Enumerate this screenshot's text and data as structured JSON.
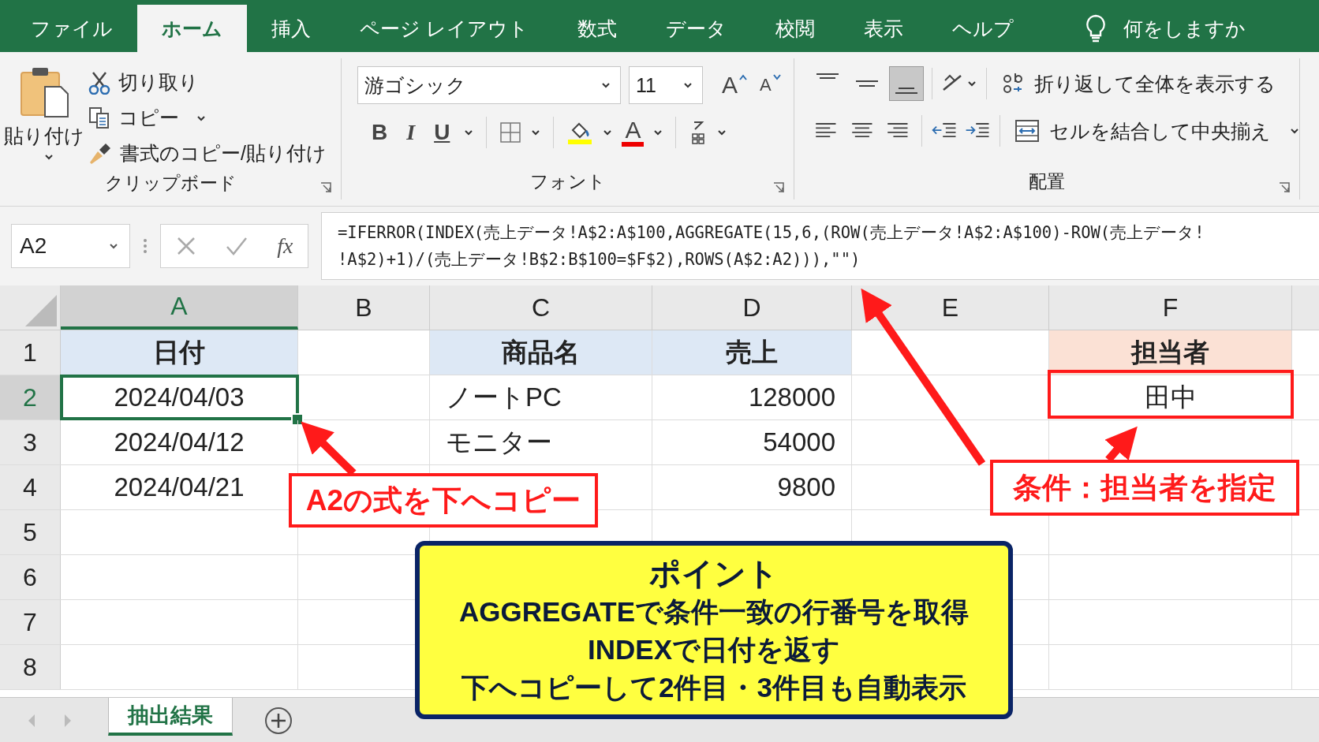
{
  "tabs": [
    {
      "label": "ファイル",
      "selected": false
    },
    {
      "label": "ホーム",
      "selected": true
    },
    {
      "label": "挿入",
      "selected": false
    },
    {
      "label": "ページ レイアウト",
      "selected": false
    },
    {
      "label": "数式",
      "selected": false
    },
    {
      "label": "データ",
      "selected": false
    },
    {
      "label": "校閲",
      "selected": false
    },
    {
      "label": "表示",
      "selected": false
    },
    {
      "label": "ヘルプ",
      "selected": false
    }
  ],
  "tell_me": "何をしますか",
  "clipboard": {
    "paste": "貼り付け",
    "cut": "切り取り",
    "copy": "コピー",
    "format_painter": "書式のコピー/貼り付け",
    "group_label": "クリップボード"
  },
  "font": {
    "name": "游ゴシック",
    "size": "11",
    "grow": "A",
    "shrink": "A",
    "bold": "B",
    "italic": "I",
    "underline": "U",
    "font_color": "A",
    "group_label": "フォント"
  },
  "alignment": {
    "wrap_text": "折り返して全体を表示する",
    "merge": "セルを結合して中央揃え",
    "group_label": "配置"
  },
  "formula_bar": {
    "name_box": "A2",
    "fx": "fx",
    "formula_lines": [
      "=IFERROR(INDEX(売上データ!A$2:A$100,AGGREGATE(15,6,(ROW(売上データ!A$2:A$100)-ROW(売上データ!",
      "!A$2)+1)/(売上データ!B$2:B$100=$F$2),ROWS(A$2:A2))),\"\")"
    ]
  },
  "columns": [
    {
      "label": "A",
      "selected": true
    },
    {
      "label": "B",
      "selected": false
    },
    {
      "label": "C",
      "selected": false
    },
    {
      "label": "D",
      "selected": false
    },
    {
      "label": "E",
      "selected": false
    },
    {
      "label": "F",
      "selected": false
    }
  ],
  "rows": [
    {
      "label": "1",
      "selected": false,
      "cells": [
        {
          "text": "日付",
          "kind": "header",
          "color": "#dde8f5"
        },
        null,
        {
          "text": "商品名",
          "kind": "header",
          "color": "#dde8f5"
        },
        {
          "text": "売上",
          "kind": "header",
          "color": "#dde8f5"
        },
        null,
        {
          "text": "担当者",
          "kind": "header",
          "color": "#fbe1d5"
        }
      ]
    },
    {
      "label": "2",
      "selected": true,
      "cells": [
        {
          "text": "2024/04/03",
          "kind": "date",
          "selected": true
        },
        null,
        {
          "text": "ノートPC",
          "kind": "text"
        },
        {
          "text": "128000",
          "kind": "number"
        },
        null,
        {
          "text": "田中",
          "kind": "date"
        }
      ]
    },
    {
      "label": "3",
      "selected": false,
      "cells": [
        {
          "text": "2024/04/12",
          "kind": "date"
        },
        null,
        {
          "text": "モニター",
          "kind": "text"
        },
        {
          "text": "54000",
          "kind": "number"
        },
        null,
        null
      ]
    },
    {
      "label": "4",
      "selected": false,
      "cells": [
        {
          "text": "2024/04/21",
          "kind": "date"
        },
        null,
        null,
        {
          "text": "9800",
          "kind": "number"
        },
        null,
        null
      ]
    },
    {
      "label": "5",
      "selected": false
    },
    {
      "label": "6",
      "selected": false
    },
    {
      "label": "7",
      "selected": false
    },
    {
      "label": "8",
      "selected": false
    }
  ],
  "sheet_tabs": [
    {
      "label": "抽出結果",
      "selected": true
    }
  ],
  "callouts": [
    {
      "text": "A2の式を下へコピー"
    },
    {
      "text": "条件：担当者を指定"
    }
  ],
  "point_box": {
    "title": "ポイント",
    "lines": [
      "AGGREGATEで条件一致の行番号を取得",
      "INDEXで日付を返す",
      "下へコピーして2件目・3件目も自動表示"
    ]
  }
}
